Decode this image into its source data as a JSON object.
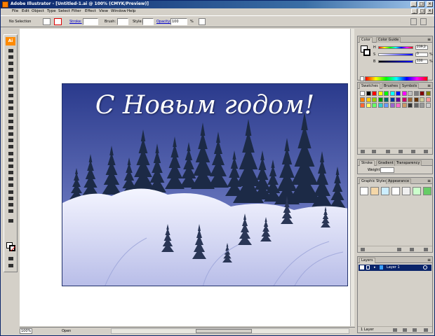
{
  "window": {
    "title": "Adobe Illustrator - [Untitled-1.ai @ 100% (CMYK/Preview)]"
  },
  "caption_buttons": [
    "_",
    "□",
    "×"
  ],
  "menu": [
    "File",
    "Edit",
    "Object",
    "Type",
    "Select",
    "Filter",
    "Effect",
    "View",
    "Window",
    "Help"
  ],
  "control_bar": {
    "selection": "No Selection",
    "stroke_label": "Stroke:",
    "brush_label": "Brush:",
    "style_label": "Style:",
    "opacity_label": "Opacity:",
    "opacity_value": "100",
    "opacity_unit": "%"
  },
  "artwork": {
    "greeting": "С Новым годом!",
    "colors": {
      "sky_top": "#2a3a8c",
      "sky_bottom": "#8a96d8",
      "snow": "#eef0ff",
      "tree": "#1c2a46"
    }
  },
  "color_panel": {
    "tabs": [
      "Color",
      "Color Guide"
    ],
    "channels": [
      {
        "label": "H",
        "value": "239,2"
      },
      {
        "label": "S",
        "value": "0"
      },
      {
        "label": "B",
        "value": "100"
      }
    ],
    "pct": "%"
  },
  "swatches_panel": {
    "tabs": [
      "Swatches",
      "Brushes",
      "Symbols"
    ],
    "colors": [
      "#ffffff",
      "#000000",
      "#ff0000",
      "#ffff00",
      "#00ff00",
      "#00ffff",
      "#0000ff",
      "#ff00ff",
      "#c0c0c0",
      "#808080",
      "#800000",
      "#808000",
      "#ff8000",
      "#ffcc00",
      "#99cc00",
      "#009900",
      "#006666",
      "#003399",
      "#660099",
      "#cc0066",
      "#996633",
      "#663300",
      "#cccc99",
      "#ff9999",
      "#ff6633",
      "#ffff66",
      "#66ff66",
      "#33cccc",
      "#6699ff",
      "#9966cc",
      "#ff66cc",
      "#cc9966",
      "#333333",
      "#666666",
      "#999999",
      "#cccccc"
    ]
  },
  "stroke_panel": {
    "tabs": [
      "Stroke",
      "Gradient",
      "Transparency"
    ],
    "weight_label": "Weight:"
  },
  "graphic_styles_panel": {
    "tabs": [
      "Graphic Styles",
      "Appearance"
    ],
    "styles": [
      "#ffffff",
      "#f4d7a8",
      "#cceeff",
      "#ffffff",
      "#f0f0f0",
      "#ccffcc",
      "#66cc66"
    ]
  },
  "layers_panel": {
    "tabs": [
      "Layers"
    ],
    "layer_name": "Layer 1",
    "count": "1 Layer"
  },
  "status": {
    "zoom": "100%",
    "info": "Open"
  },
  "toolbox": {
    "logo": "Ai"
  }
}
